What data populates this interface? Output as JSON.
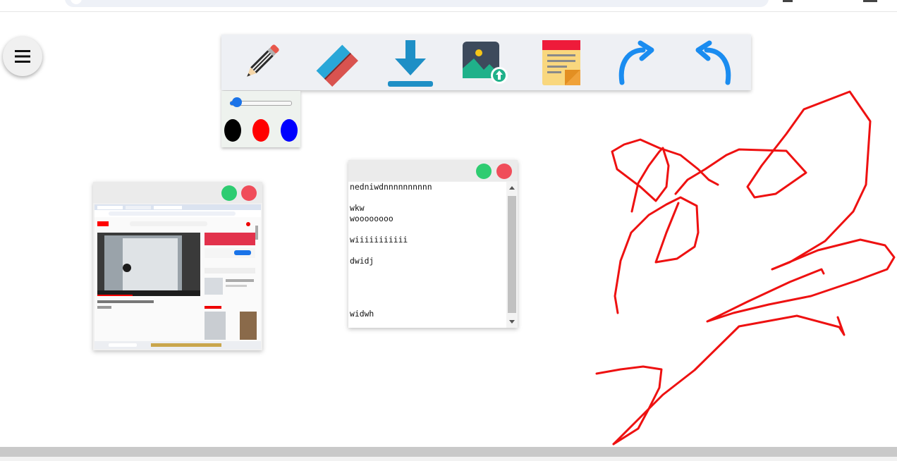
{
  "toolbar": {
    "tools": [
      {
        "icon": "pencil-icon"
      },
      {
        "icon": "eraser-icon"
      },
      {
        "icon": "download-icon"
      },
      {
        "icon": "image-upload-icon"
      },
      {
        "icon": "sticky-note-icon"
      },
      {
        "icon": "redo-icon"
      },
      {
        "icon": "undo-icon"
      }
    ]
  },
  "pen_panel": {
    "size_level": 0.12,
    "colors": [
      "#000000",
      "#ff0000",
      "#0000ff"
    ]
  },
  "note": {
    "text": "nedniwdnnnnnnnnnn\n\nwkw\nwoooooooo\n\nwiiiiiiiiiii\n\ndwidj\n\n\n\n\nwidwh"
  },
  "colors": {
    "accent": "#1a73e8",
    "stroke": "#ee1111",
    "window_green": "#2ecc71",
    "window_red": "#f04d5a"
  }
}
